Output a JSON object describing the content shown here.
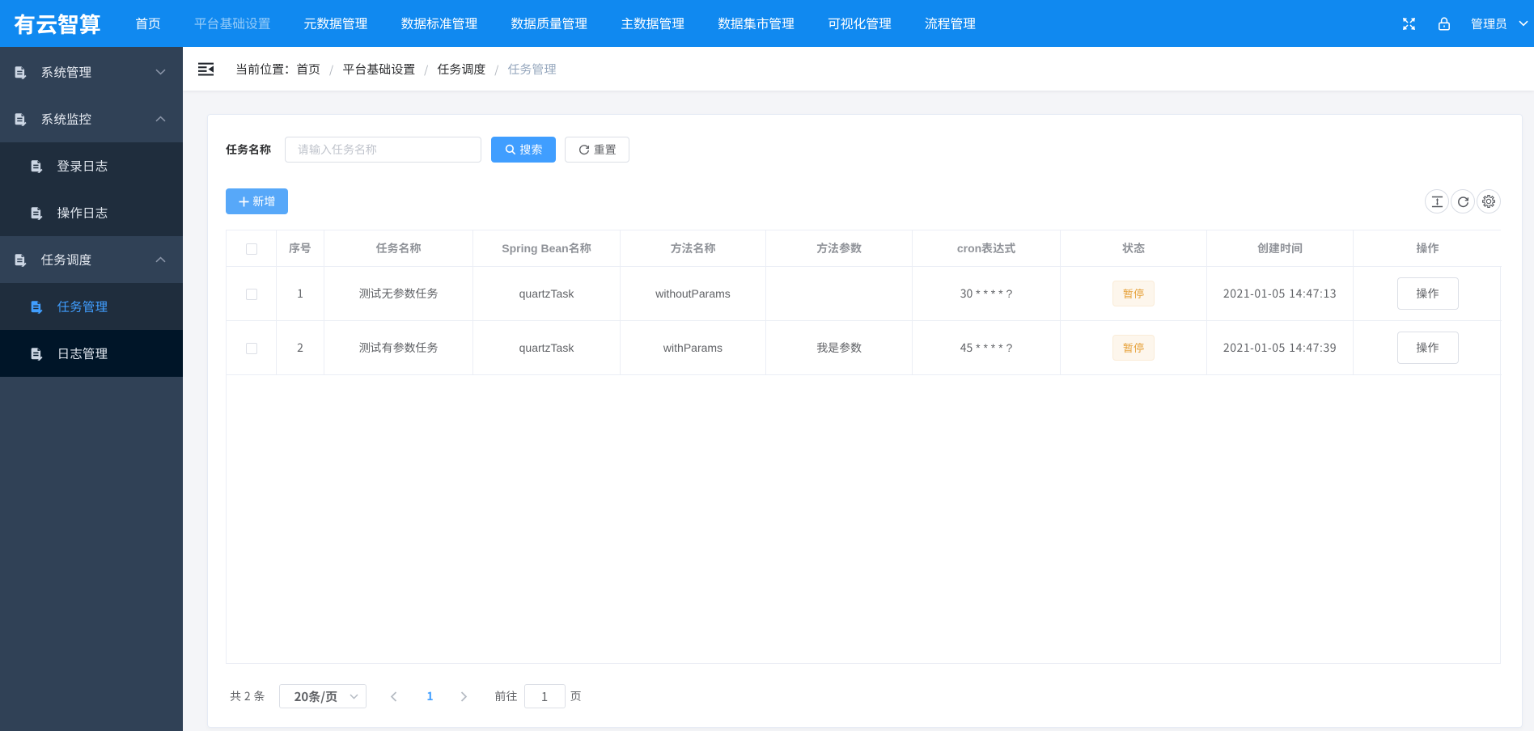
{
  "topbar": {
    "logo": "有云智算",
    "nav": [
      {
        "label": "首页"
      },
      {
        "label": "平台基础设置",
        "active": true
      },
      {
        "label": "元数据管理"
      },
      {
        "label": "数据标准管理"
      },
      {
        "label": "数据质量管理"
      },
      {
        "label": "主数据管理"
      },
      {
        "label": "数据集市管理"
      },
      {
        "label": "可视化管理"
      },
      {
        "label": "流程管理"
      }
    ],
    "icons": {
      "fullscreen": "fullscreen-icon",
      "lock": "lock-icon",
      "user_dropdown": "chevron-down-icon"
    },
    "user": {
      "name": "管理员"
    }
  },
  "sidebar": {
    "items": [
      {
        "label": "系统管理",
        "level": 1,
        "state": "collapsed",
        "icon": "document-edit-icon"
      },
      {
        "label": "系统监控",
        "level": 1,
        "state": "expanded",
        "icon": "document-edit-icon"
      },
      {
        "label": "登录日志",
        "level": 2,
        "icon": "document-edit-icon"
      },
      {
        "label": "操作日志",
        "level": 2,
        "icon": "document-edit-icon"
      },
      {
        "label": "任务调度",
        "level": 1,
        "state": "expanded",
        "icon": "document-edit-icon"
      },
      {
        "label": "任务管理",
        "level": 2,
        "active": true,
        "icon": "document-edit-icon"
      },
      {
        "label": "日志管理",
        "level": 2,
        "hovered": true,
        "icon": "document-edit-icon"
      }
    ]
  },
  "breadcrumb": {
    "prefix": "当前位置：",
    "separator": "/",
    "items": [
      "首页",
      "平台基础设置",
      "任务调度",
      "任务管理"
    ]
  },
  "search": {
    "label": "任务名称",
    "input_value": "",
    "input_placeholder": "请输入任务名称",
    "search_button": "搜索",
    "reset_button": "重置"
  },
  "toolbar": {
    "add_button": "新增"
  },
  "table": {
    "select_all_checked": false,
    "columns": [
      "序号",
      "任务名称",
      "Spring Bean名称",
      "方法名称",
      "方法参数",
      "cron表达式",
      "状态",
      "创建时间",
      "操作"
    ],
    "rows": [
      {
        "selected": false,
        "seq": "1",
        "job_name": "测试无参数任务",
        "bean_name": "quartzTask",
        "method_name": "withoutParams",
        "method_params": "",
        "cron": "30 * * * * ?",
        "status": "暂停",
        "create_time": "2021-01-05 14:47:13",
        "action_button": "操作"
      },
      {
        "selected": false,
        "seq": "2",
        "job_name": "测试有参数任务",
        "bean_name": "quartzTask",
        "method_name": "withParams",
        "method_params": "我是参数",
        "cron": "45 * * * * ?",
        "status": "暂停",
        "create_time": "2021-01-05 14:47:39",
        "action_button": "操作"
      }
    ]
  },
  "pagination": {
    "total_text": "共 2 条",
    "page_size": "20条/页",
    "current_page": "1",
    "goto_label": "前往",
    "goto_value": "1",
    "goto_unit": "页"
  },
  "colors": {
    "topbar_bg": "#1089f0",
    "primary": "#409eff",
    "primary_light": "#60acf9",
    "sidebar_bg": "#304156",
    "submenu_bg": "#1f2d3d",
    "submenu_hover_bg": "#001528",
    "status_warning_text": "#e6a23c",
    "status_warning_bg": "#fdf6ec"
  }
}
